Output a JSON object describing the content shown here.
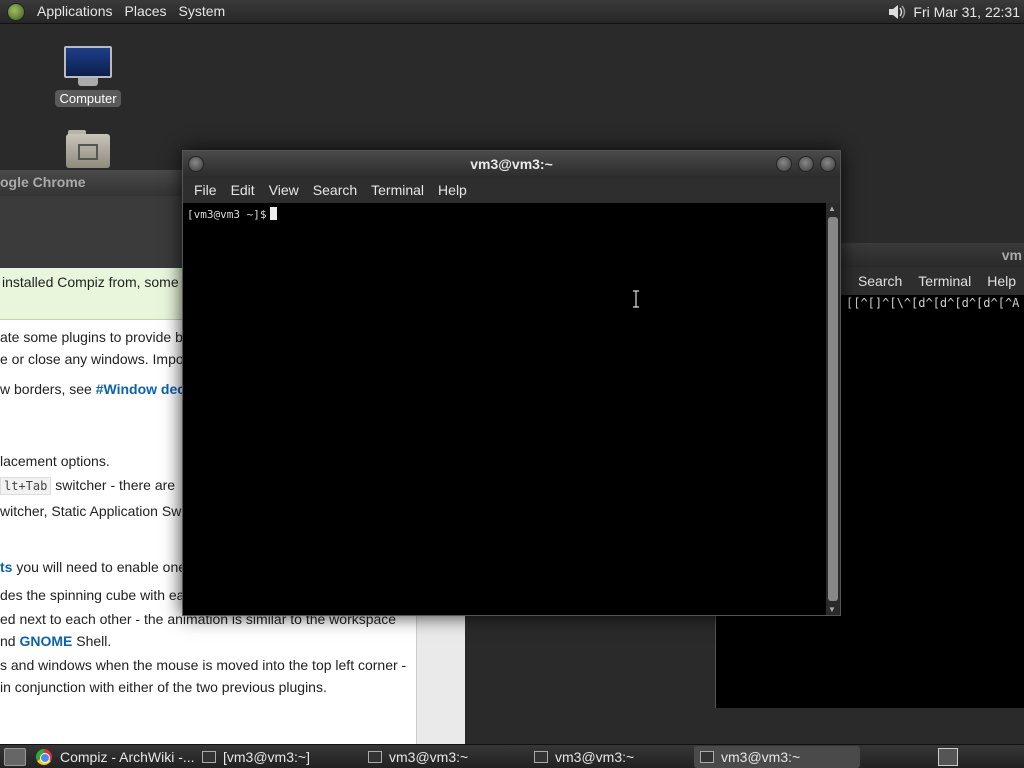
{
  "top_panel": {
    "menus": [
      "Applications",
      "Places",
      "System"
    ],
    "clock": "Fri Mar 31, 22:31",
    "volume_icon": "speaker-icon"
  },
  "desktop": {
    "icons": [
      {
        "label": "Computer",
        "icon": "computer-icon"
      },
      {
        "label": "",
        "icon": "home-folder-icon"
      }
    ]
  },
  "chrome_window": {
    "title": "ogle Chrome",
    "note_text": "installed Compiz from, some c",
    "lines": [
      {
        "text": "ate some plugins to provide b"
      },
      {
        "text": "e or close any windows. Impo"
      },
      {
        "pre": "w borders, see ",
        "link": "#Window dec"
      },
      {
        "text": "lacement options."
      },
      {
        "code": "lt+Tab",
        "post": " switcher - there are "
      },
      {
        "text": "witcher, Static Application Sw"
      },
      {
        "link": "ts",
        "post": " you will need to enable one"
      },
      {
        "text": "des the spinning cube with ea"
      },
      {
        "text": "ed next to each other - the animation is similar to the workspace"
      },
      {
        "pre": "nd ",
        "link": "GNOME",
        "post": " Shell."
      },
      {
        "text": "s and windows when the mouse is moved into the top left corner -"
      },
      {
        "text": " in conjunction with either of the two previous plugins."
      }
    ]
  },
  "back_terminal": {
    "title": "vm",
    "menus": [
      "Search",
      "Terminal",
      "Help"
    ],
    "output": "[[^[]^[\\^[d^[d^[d^[d^[^A"
  },
  "front_terminal": {
    "title": "vm3@vm3:~",
    "menus": [
      "File",
      "Edit",
      "View",
      "Search",
      "Terminal",
      "Help"
    ],
    "prompt": "[vm3@vm3 ~]$"
  },
  "taskbar": {
    "tasks": [
      {
        "label": "Compiz - ArchWiki -...",
        "icon": "chrome-icon"
      },
      {
        "label": "[vm3@vm3:~]",
        "icon": "terminal-icon"
      },
      {
        "label": "vm3@vm3:~",
        "icon": "terminal-icon"
      },
      {
        "label": "vm3@vm3:~",
        "icon": "terminal-icon"
      },
      {
        "label": "vm3@vm3:~",
        "icon": "terminal-icon"
      }
    ]
  }
}
